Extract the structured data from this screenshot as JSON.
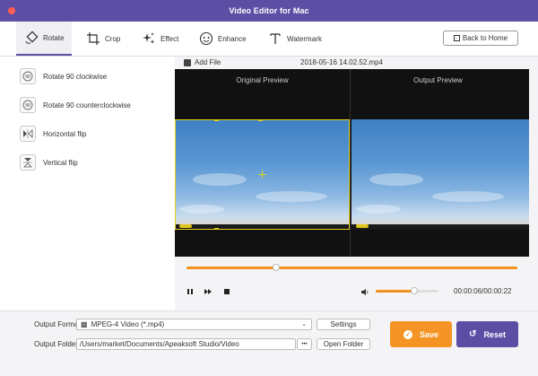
{
  "window": {
    "title": "Video Editor for Mac"
  },
  "tabs": [
    {
      "label": "Rotate",
      "icon": "rotate-icon"
    },
    {
      "label": "Crop",
      "icon": "crop-icon"
    },
    {
      "label": "Effect",
      "icon": "effect-icon"
    },
    {
      "label": "Enhance",
      "icon": "enhance-icon"
    },
    {
      "label": "Watermark",
      "icon": "watermark-icon"
    }
  ],
  "back_button": {
    "label": "Back to Home"
  },
  "rotate_options": [
    {
      "label": "Rotate 90 clockwise",
      "icon_text": "90"
    },
    {
      "label": "Rotate 90 counterclockwise",
      "icon_text": "90"
    },
    {
      "label": "Horizontal flip"
    },
    {
      "label": "Vertical flip"
    }
  ],
  "file": {
    "add_label": "Add File",
    "name": "2018-05-16 14.02.52.mp4"
  },
  "preview": {
    "original_label": "Original Preview",
    "output_label": "Output Preview"
  },
  "playback": {
    "time": "00:00:06/00:00:22",
    "progress": 0.27,
    "volume": 0.6
  },
  "output": {
    "format_label": "Output Format:",
    "format_value": "MPEG-4 Video (*.mp4)",
    "settings_label": "Settings",
    "folder_label": "Output Folder:",
    "folder_value": "/Users/market/Documents/Apeaksoft Studio/Video",
    "browse_label": "•••",
    "open_folder_label": "Open Folder"
  },
  "actions": {
    "save_label": "Save",
    "reset_label": "Reset"
  },
  "colors": {
    "accent": "#5b4ea4",
    "orange": "#f39424"
  }
}
